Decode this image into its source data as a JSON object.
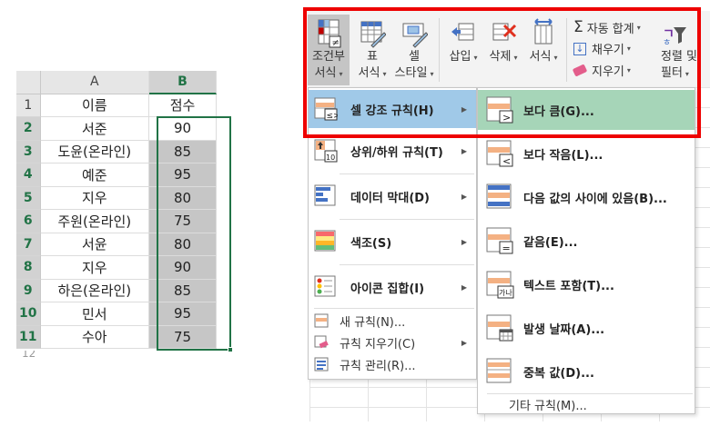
{
  "sheet": {
    "col_a": "A",
    "col_b": "B",
    "rows": [
      {
        "num": "1",
        "a": "이름",
        "b": "점수"
      },
      {
        "num": "2",
        "a": "서준",
        "b": "90"
      },
      {
        "num": "3",
        "a": "도윤(온라인)",
        "b": "85"
      },
      {
        "num": "4",
        "a": "예준",
        "b": "95"
      },
      {
        "num": "5",
        "a": "지우",
        "b": "80"
      },
      {
        "num": "6",
        "a": "주원(온라인)",
        "b": "75"
      },
      {
        "num": "7",
        "a": "서윤",
        "b": "80"
      },
      {
        "num": "8",
        "a": "지우",
        "b": "90"
      },
      {
        "num": "9",
        "a": "하은(온라인)",
        "b": "85"
      },
      {
        "num": "10",
        "a": "민서",
        "b": "95"
      },
      {
        "num": "11",
        "a": "수아",
        "b": "75"
      }
    ],
    "partial_row": "12"
  },
  "ribbon": {
    "cond_format_l1": "조건부",
    "cond_format_l2": "서식",
    "table_l1": "표",
    "table_l2": "서식",
    "cell_l1": "셀",
    "cell_l2": "스타일",
    "insert": "삽입",
    "delete": "삭제",
    "format": "서식",
    "autosum": "자동 합계",
    "fill": "채우기",
    "clear": "지우기",
    "sort_l1": "정렬 및",
    "sort_l2": "필터"
  },
  "menu": {
    "items": [
      {
        "label": "셀 강조 규칙(H)"
      },
      {
        "label": "상위/하위 규칙(T)"
      },
      {
        "label": "데이터 막대(D)"
      },
      {
        "label": "색조(S)"
      },
      {
        "label": "아이콘 집합(I)"
      }
    ],
    "new_rule": "새 규칙(N)...",
    "clear_rules": "규칙 지우기(C)",
    "manage_rules": "규칙 관리(R)..."
  },
  "submenu": {
    "items": [
      {
        "label": "보다 큼(G)..."
      },
      {
        "label": "보다 작음(L)..."
      },
      {
        "label": "다음 값의 사이에 있음(B)..."
      },
      {
        "label": "같음(E)..."
      },
      {
        "label": "텍스트 포함(T)..."
      },
      {
        "label": "발생 날짜(A)..."
      },
      {
        "label": "중복 값(D)..."
      }
    ],
    "other_rules": "기타 규칙(M)...",
    "icon_text_ganada": "가나",
    "icon_text_10": "10"
  }
}
